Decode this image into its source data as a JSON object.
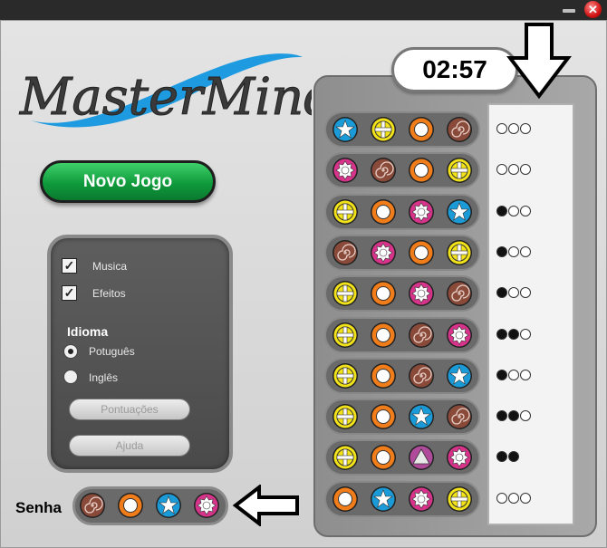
{
  "window": {
    "minimize_icon": "minimize-icon",
    "close_glyph": "✕"
  },
  "logo": {
    "text": "MasterMind"
  },
  "novo_jogo_label": "Novo Jogo",
  "options": {
    "musica_label": "Musica",
    "efeitos_label": "Efeitos",
    "musica_checked": true,
    "efeitos_checked": true,
    "check_glyph": "✓",
    "idioma_label": "Idioma",
    "portugues_label": "Potuguês",
    "ingles_label": "Inglês",
    "selected_language": "Potuguês",
    "pontuacoes_label": "Pontuações",
    "ajuda_label": "Ajuda"
  },
  "timer": "02:57",
  "senha_label": "Senha",
  "secret": [
    "brown-spiral",
    "orange-ring",
    "blue-star",
    "pink-sun"
  ],
  "guesses": [
    {
      "pegs": [
        "blue-star",
        "yellow-cross",
        "orange-ring",
        "brown-spiral"
      ],
      "feedback": [
        "white",
        "white",
        "white"
      ]
    },
    {
      "pegs": [
        "pink-sun",
        "brown-spiral",
        "orange-ring",
        "yellow-cross"
      ],
      "feedback": [
        "white",
        "white",
        "white"
      ]
    },
    {
      "pegs": [
        "yellow-cross",
        "orange-ring",
        "pink-sun",
        "blue-star"
      ],
      "feedback": [
        "black",
        "white",
        "white"
      ]
    },
    {
      "pegs": [
        "brown-spiral",
        "pink-sun",
        "orange-ring",
        "yellow-cross"
      ],
      "feedback": [
        "black",
        "white",
        "white"
      ]
    },
    {
      "pegs": [
        "yellow-cross",
        "orange-ring",
        "pink-sun",
        "brown-spiral"
      ],
      "feedback": [
        "black",
        "white",
        "white"
      ]
    },
    {
      "pegs": [
        "yellow-cross",
        "orange-ring",
        "brown-spiral",
        "pink-sun"
      ],
      "feedback": [
        "black",
        "black",
        "white"
      ]
    },
    {
      "pegs": [
        "yellow-cross",
        "orange-ring",
        "brown-spiral",
        "blue-star"
      ],
      "feedback": [
        "black",
        "white",
        "white"
      ]
    },
    {
      "pegs": [
        "yellow-cross",
        "orange-ring",
        "blue-star",
        "brown-spiral"
      ],
      "feedback": [
        "black",
        "black",
        "white"
      ]
    },
    {
      "pegs": [
        "yellow-cross",
        "orange-ring",
        "pink-triangle",
        "pink-sun"
      ],
      "feedback": [
        "black",
        "black"
      ]
    },
    {
      "pegs": [
        "orange-ring",
        "blue-star",
        "pink-sun",
        "yellow-cross"
      ],
      "feedback": [
        "white",
        "white",
        "white"
      ]
    }
  ],
  "colors": {
    "blue-star": "#1a9ad6",
    "yellow-cross": "#f2e21a",
    "orange-ring": "#f07d1a",
    "brown-spiral": "#8a4a3a",
    "pink-sun": "#d8338a",
    "pink-triangle": "#c0307a"
  }
}
